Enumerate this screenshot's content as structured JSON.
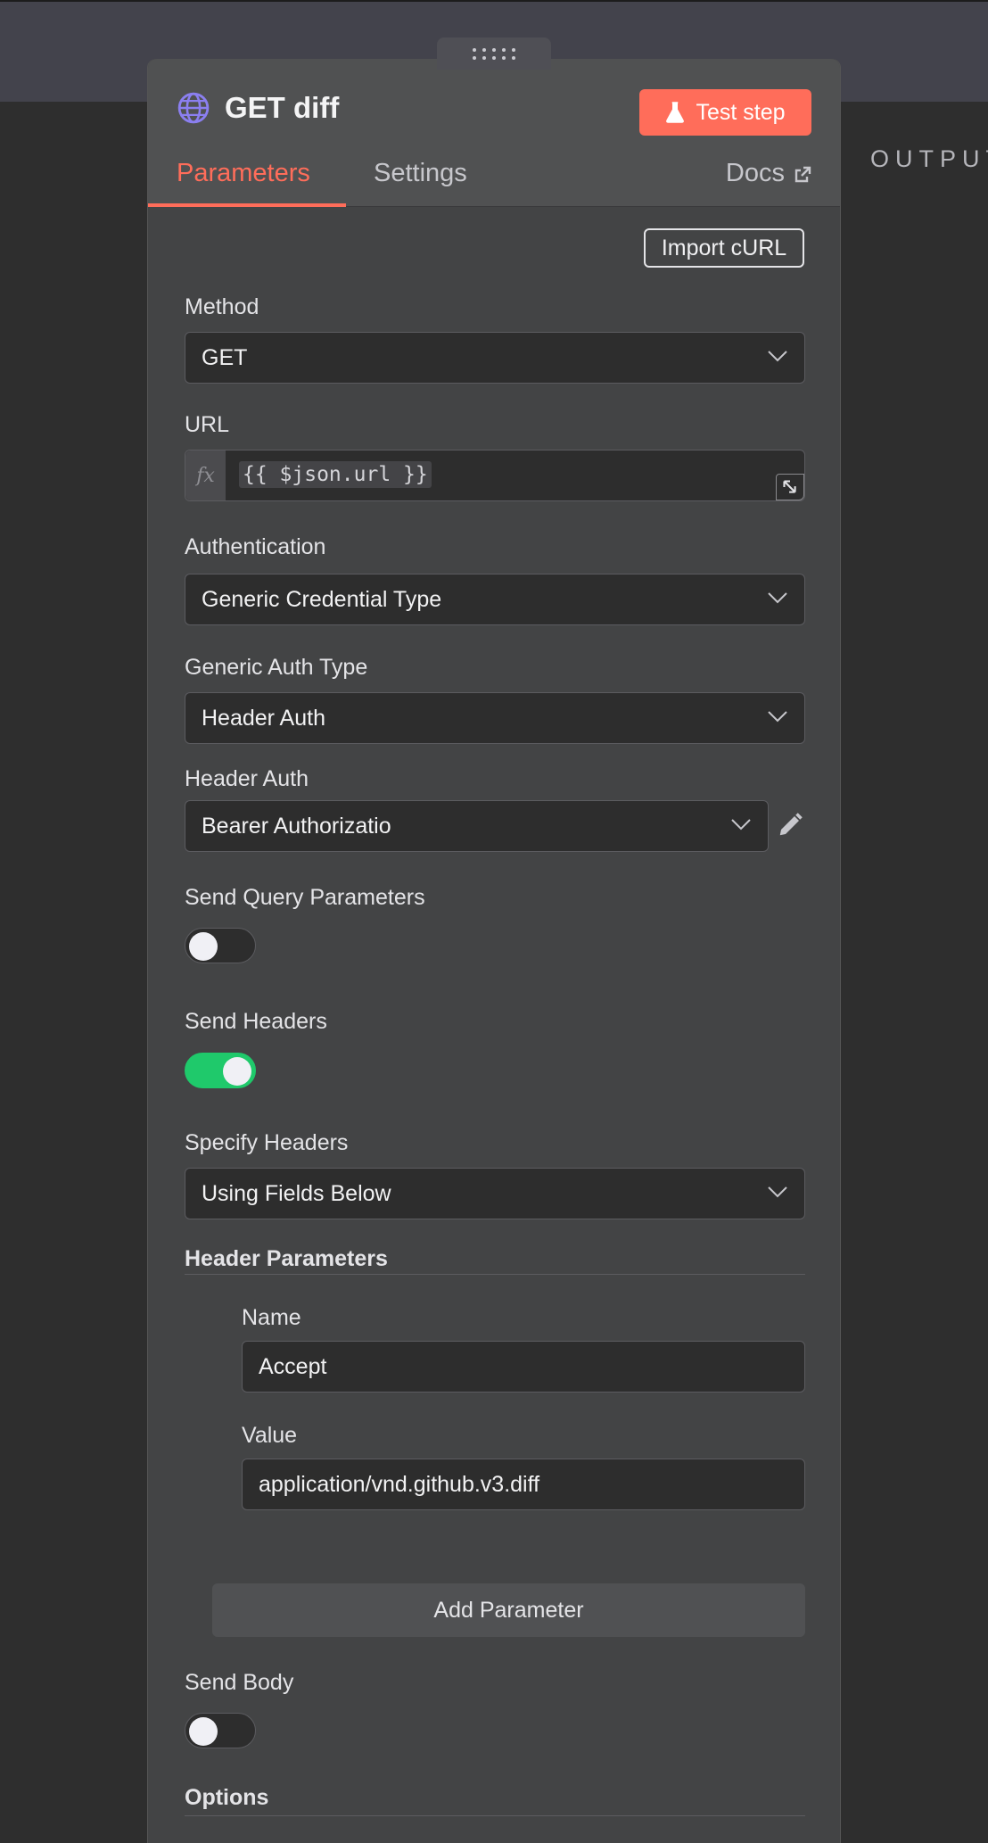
{
  "canvas": {
    "output_label": "OUTPUT"
  },
  "node": {
    "title": "GET diff",
    "test_button": "Test step",
    "tabs": [
      {
        "label": "Parameters",
        "active": true
      },
      {
        "label": "Settings",
        "active": false
      }
    ],
    "docs_label": "Docs",
    "accent_color": "#ff6d5a"
  },
  "params": {
    "import_curl": "Import cURL",
    "method": {
      "label": "Method",
      "value": "GET"
    },
    "url": {
      "label": "URL",
      "value": "{{ $json.url }}",
      "fx": "fx"
    },
    "authentication": {
      "label": "Authentication",
      "value": "Generic Credential Type"
    },
    "generic_auth_type": {
      "label": "Generic Auth Type",
      "value": "Header Auth"
    },
    "header_auth": {
      "label": "Header Auth",
      "value": "Bearer Authorizatio"
    },
    "send_query": {
      "label": "Send Query Parameters",
      "enabled": false
    },
    "send_headers": {
      "label": "Send Headers",
      "enabled": true
    },
    "specify_headers": {
      "label": "Specify Headers",
      "value": "Using Fields Below"
    },
    "header_parameters": {
      "label": "Header Parameters",
      "items": [
        {
          "name_label": "Name",
          "name": "Accept",
          "value_label": "Value",
          "value": "application/vnd.github.v3.diff"
        }
      ],
      "add_button": "Add Parameter"
    },
    "send_body": {
      "label": "Send Body",
      "enabled": false
    },
    "options": {
      "label": "Options"
    }
  },
  "icons": {
    "globe": "globe-icon",
    "flask": "flask-icon",
    "external": "external-link-icon",
    "chevron": "chevron-down-icon",
    "pencil": "pencil-icon",
    "expand": "expand-icon",
    "drag": "drag-handle-icon"
  }
}
